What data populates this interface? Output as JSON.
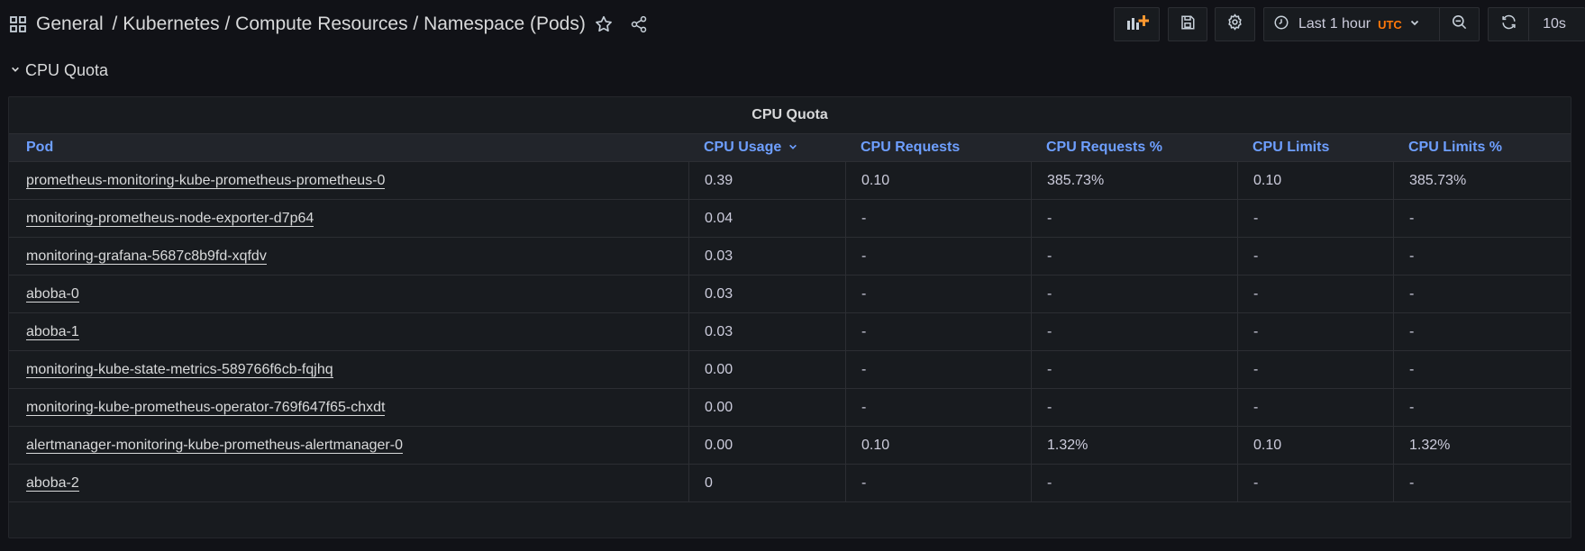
{
  "nav": {
    "breadcrumb": {
      "folder": "General",
      "separator": " / ",
      "title": "Kubernetes / Compute Resources / Namespace (Pods)"
    },
    "time_picker": {
      "label": "Last 1 hour",
      "timezone": "UTC"
    },
    "refresh_interval": "10s",
    "icons": [
      "apps-icon",
      "star-icon",
      "share-icon",
      "add-panel-icon",
      "save-icon",
      "gear-icon",
      "clock-icon",
      "chevron-down-icon",
      "zoom-out-icon",
      "refresh-icon"
    ]
  },
  "row": {
    "title": "CPU Quota",
    "expanded": true
  },
  "panel": {
    "title": "CPU Quota",
    "columns": [
      "Pod",
      "CPU Usage",
      "CPU Requests",
      "CPU Requests %",
      "CPU Limits",
      "CPU Limits %"
    ],
    "sorted_column": "CPU Usage",
    "sort_direction": "desc",
    "rows": [
      [
        "prometheus-monitoring-kube-prometheus-prometheus-0",
        "0.39",
        "0.10",
        "385.73%",
        "0.10",
        "385.73%"
      ],
      [
        "monitoring-prometheus-node-exporter-d7p64",
        "0.04",
        "-",
        "-",
        "-",
        "-"
      ],
      [
        "monitoring-grafana-5687c8b9fd-xqfdv",
        "0.03",
        "-",
        "-",
        "-",
        "-"
      ],
      [
        "aboba-0",
        "0.03",
        "-",
        "-",
        "-",
        "-"
      ],
      [
        "aboba-1",
        "0.03",
        "-",
        "-",
        "-",
        "-"
      ],
      [
        "monitoring-kube-state-metrics-589766f6cb-fqjhq",
        "0.00",
        "-",
        "-",
        "-",
        "-"
      ],
      [
        "monitoring-kube-prometheus-operator-769f647f65-chxdt",
        "0.00",
        "-",
        "-",
        "-",
        "-"
      ],
      [
        "alertmanager-monitoring-kube-prometheus-alertmanager-0",
        "0.00",
        "0.10",
        "1.32%",
        "0.10",
        "1.32%"
      ],
      [
        "aboba-2",
        "0",
        "-",
        "-",
        "-",
        "-"
      ]
    ]
  },
  "colors": {
    "background": "#111217",
    "panel": "#181b1f",
    "header_link": "#6e9fff",
    "utc_accent": "#ff780a",
    "text": "#ccccdc"
  }
}
